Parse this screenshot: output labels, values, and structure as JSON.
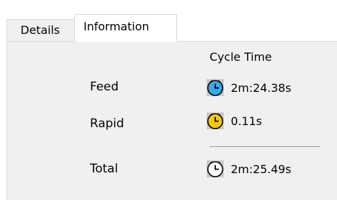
{
  "tabs": {
    "details": "Details",
    "information": "Information"
  },
  "column_header": "Cycle Time",
  "rows": {
    "feed": {
      "label": "Feed",
      "value": "2m:24.38s",
      "icon": "clock-icon-blue"
    },
    "rapid": {
      "label": "Rapid",
      "value": "0.11s",
      "icon": "clock-icon-yellow"
    },
    "total": {
      "label": "Total",
      "value": "2m:25.49s",
      "icon": "clock-icon-white"
    }
  },
  "colors": {
    "feed_clock": "#3aa8e8",
    "rapid_clock": "#f5c800",
    "total_clock": "#ffffff",
    "panel_background": "#f0f0f0"
  }
}
